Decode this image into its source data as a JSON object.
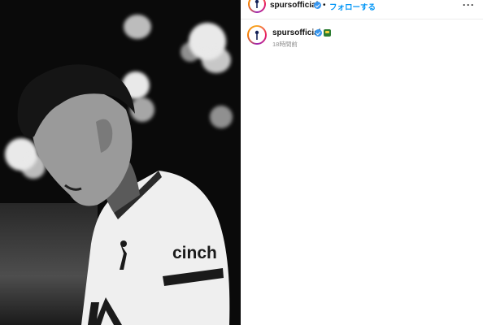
{
  "post": {
    "author": "spursofficial",
    "follow_label": "フォローする",
    "separator": "•",
    "more_label": "···",
    "caption_author": "spursofficial",
    "time_ago": "18時間前"
  },
  "photo": {
    "sponsor_text": "cinch"
  },
  "colors": {
    "follow_blue": "#0095f6",
    "verified_blue": "#3897f0"
  }
}
